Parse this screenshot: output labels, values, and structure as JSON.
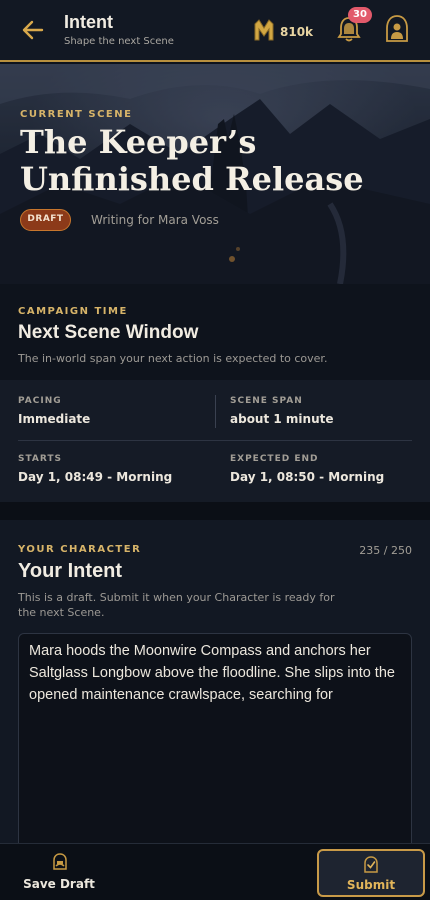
{
  "header": {
    "title": "Intent",
    "subtitle": "Shape the next Scene",
    "coins": "810k",
    "notifications": "30",
    "icons": [
      "back-arrow-icon",
      "coin-emblem-icon",
      "bell-icon",
      "profile-icon"
    ]
  },
  "hero": {
    "label": "CURRENT SCENE",
    "title": "The Keeper’s Unfinished Release",
    "status": "DRAFT",
    "writing_for": "Writing for Mara Voss"
  },
  "campaign": {
    "label": "CAMPAIGN TIME",
    "title": "Next Scene Window",
    "description": "The in-world span your next action is expected to cover.",
    "pacing_label": "PACING",
    "pacing_value": "Immediate",
    "span_label": "SCENE SPAN",
    "span_value": "about 1 minute",
    "starts_label": "STARTS",
    "starts_value": "Day 1, 08:49 - Morning",
    "end_label": "EXPECTED END",
    "end_value": "Day 1, 08:50 - Morning"
  },
  "intent": {
    "label": "YOUR CHARACTER",
    "counter": "235 / 250",
    "title": "Your Intent",
    "description": "This is a draft. Submit it when your Character is ready for the next Scene.",
    "text": "Mara hoods the Moonwire Compass and anchors her Saltglass Longbow above the floodline. She slips into the opened maintenance crawlspace, searching for"
  },
  "actions": {
    "save_label": "Save Draft",
    "submit_label": "Submit"
  },
  "colors": {
    "accent": "#d7b469",
    "draft_badge": "#8c3a19",
    "notification_badge": "#e25a6b",
    "background": "#0e131c"
  }
}
